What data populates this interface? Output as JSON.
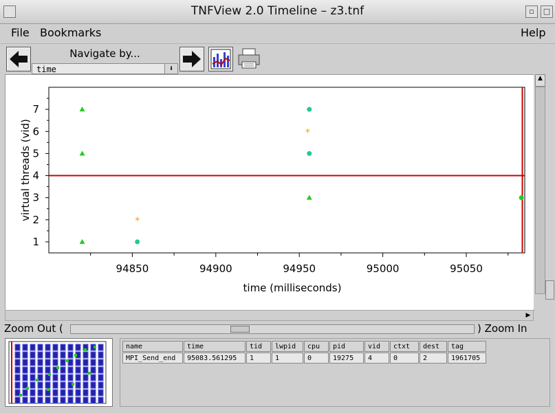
{
  "window": {
    "title": "TNFView 2.0 Timeline – z3.tnf"
  },
  "menu": {
    "file": "File",
    "bookmarks": "Bookmarks",
    "help": "Help"
  },
  "toolbar": {
    "navigate_label": "Navigate by...",
    "navigate_value": "time",
    "back_icon": "left-arrow-icon",
    "forward_icon": "right-arrow-icon",
    "chart_icon": "chart-icon",
    "print_icon": "printer-icon"
  },
  "chart_data": {
    "type": "scatter",
    "xlabel": "time (milliseconds)",
    "ylabel": "virtual threads (vid)",
    "xlim": [
      94800,
      95085
    ],
    "ylim": [
      0.5,
      8.0
    ],
    "x_ticks": [
      94850,
      94900,
      94950,
      95000,
      95050
    ],
    "y_ticks": [
      1,
      2,
      3,
      4,
      5,
      6,
      7
    ],
    "cursor": {
      "vid": 4,
      "time": 95083.561295,
      "color": "#d00000"
    },
    "points": [
      {
        "x": 94820,
        "y": 1,
        "marker": "triangle",
        "color": "#22cc22"
      },
      {
        "x": 94820,
        "y": 5,
        "marker": "triangle",
        "color": "#22cc22"
      },
      {
        "x": 94820,
        "y": 7,
        "marker": "triangle",
        "color": "#22cc22"
      },
      {
        "x": 94853,
        "y": 2,
        "marker": "star",
        "color": "#ff9900"
      },
      {
        "x": 94853,
        "y": 1,
        "marker": "circle",
        "color": "#22cc88"
      },
      {
        "x": 94956,
        "y": 7,
        "marker": "circle",
        "color": "#22cc88"
      },
      {
        "x": 94955,
        "y": 6,
        "marker": "star",
        "color": "#ff9900"
      },
      {
        "x": 94956,
        "y": 5,
        "marker": "circle",
        "color": "#22cc88"
      },
      {
        "x": 94956,
        "y": 3,
        "marker": "triangle",
        "color": "#22cc22"
      },
      {
        "x": 95083,
        "y": 3,
        "marker": "circle",
        "color": "#22cc22"
      }
    ]
  },
  "zoom": {
    "out_label": "Zoom Out (",
    "in_label": ") Zoom In"
  },
  "table": {
    "headers": [
      "name",
      "time",
      "tid",
      "lwpid",
      "cpu",
      "pid",
      "vid",
      "ctxt",
      "dest",
      "tag"
    ],
    "rows": [
      [
        "MPI_Send_end",
        "95083.561295",
        "1",
        "1",
        "0",
        "19275",
        "4",
        "0",
        "2",
        "1961705"
      ]
    ]
  }
}
